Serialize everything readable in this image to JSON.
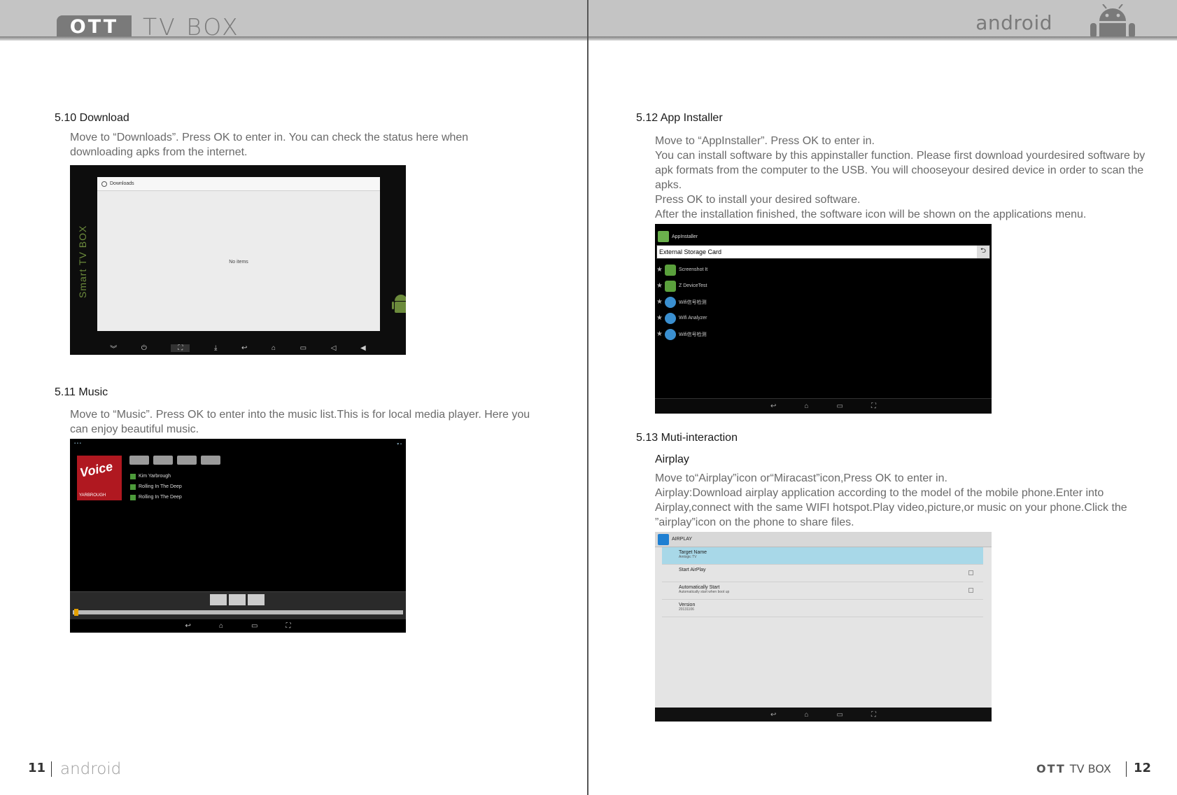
{
  "header": {
    "brand_badge": "OTT",
    "brand_text": "TV BOX",
    "android_text": "android"
  },
  "left": {
    "sec_510": {
      "title": "5.10 Download",
      "text": "Move to “Downloads”. Press OK to enter in. You can check the status here when downloading apks from the internet.",
      "screenshot": {
        "side_label": "Smart TV BOX",
        "window_title": "Downloads",
        "empty_text": "No items"
      }
    },
    "sec_511": {
      "title": "5.11 Music",
      "text": "Move to “Music”. Press OK to enter into the music list.This is for local media player. Here you can enjoy beautiful music.",
      "screenshot": {
        "cover_title": "Voice",
        "cover_name": "YARBROUGH",
        "tracks": [
          "Kim Yarbrough",
          "Rolling In The Deep",
          "Rolling In The Deep"
        ]
      }
    },
    "footer": {
      "page_number": "11",
      "android_text": "android"
    }
  },
  "right": {
    "sec_512": {
      "title": "5.12 App Installer",
      "text_lines": [
        "Move to “AppInstaller”. Press OK to enter in.",
        "You can install software by this appinstaller function. Please first download yourdesired software by apk formats from the computer to the USB. You will chooseyour desired device in order to scan the apks.",
        "Press OK to install your desired software.",
        "After the installation finished, the software icon will be shown on the applications menu."
      ],
      "screenshot": {
        "app_title": "AppInstaller",
        "storage_label": "External Storage Card",
        "rows": [
          "Screenshot It",
          "Z DeviceTest",
          "Wifi信号检测",
          "Wifi Analyzer",
          "Wifi信号检测"
        ]
      }
    },
    "sec_513": {
      "title": "5.13 Muti-interaction",
      "subtitle": "Airplay",
      "text_lines": [
        "Move to“Airplay”icon or“Miracast”icon,Press OK to enter in.",
        "Airplay:Download airplay application according to the model of the mobile phone.Enter into Airplay,connect with the same WIFI hotspot.Play video,picture,or music on your phone.Click the ”airplay”icon on the phone to share files."
      ],
      "screenshot": {
        "bar_title": "AIRPLAY",
        "rows": [
          {
            "label": "Target Name",
            "sub": "Amlogic TV"
          },
          {
            "label": "Start AirPlay",
            "sub": ""
          },
          {
            "label": "Automatically Start",
            "sub": "Automatically start when boot up"
          },
          {
            "label": "Version",
            "sub": "20131106"
          }
        ]
      }
    },
    "footer": {
      "brand_badge": "OTT",
      "brand_text": "TV BOX",
      "page_number": "12"
    }
  }
}
